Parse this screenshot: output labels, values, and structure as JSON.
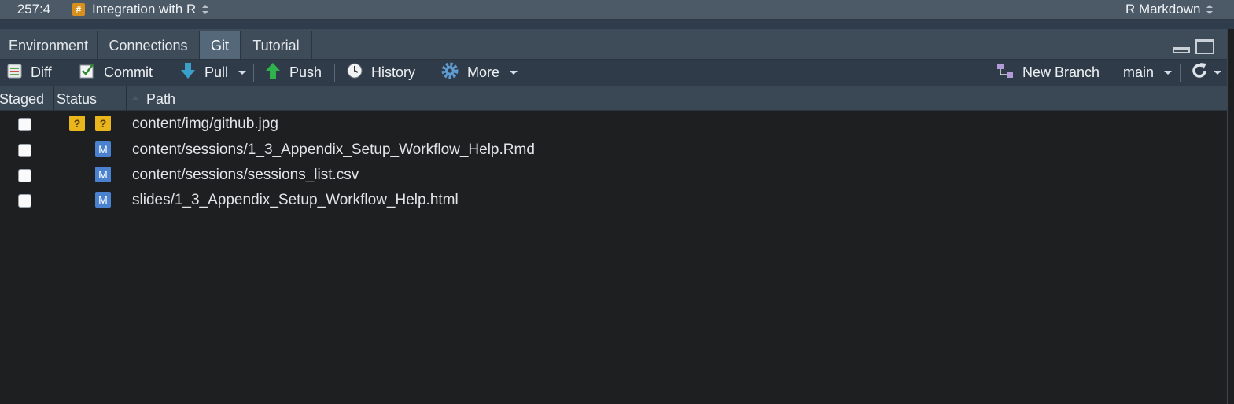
{
  "statusbar": {
    "cursor_position": "257:4",
    "section_icon": "hash-icon",
    "section_name": "Integration with R",
    "doc_type": "R Markdown"
  },
  "tabs": [
    {
      "label": "Environment",
      "active": false
    },
    {
      "label": "Connections",
      "active": false
    },
    {
      "label": "Git",
      "active": true
    },
    {
      "label": "Tutorial",
      "active": false
    }
  ],
  "toolbar": {
    "diff": "Diff",
    "commit": "Commit",
    "pull": "Pull",
    "push": "Push",
    "history": "History",
    "more": "More",
    "new_branch": "New Branch",
    "branch": "main"
  },
  "columns": {
    "staged": "Staged",
    "status": "Status",
    "path": "Path"
  },
  "files": [
    {
      "staged": false,
      "status_staged": "?",
      "status_unstaged": "?",
      "path": "content/img/github.jpg"
    },
    {
      "staged": false,
      "status_staged": "",
      "status_unstaged": "M",
      "path": "content/sessions/1_3_Appendix_Setup_Workflow_Help.Rmd"
    },
    {
      "staged": false,
      "status_staged": "",
      "status_unstaged": "M",
      "path": "content/sessions/sessions_list.csv"
    },
    {
      "staged": false,
      "status_staged": "",
      "status_unstaged": "M",
      "path": "slides/1_3_Appendix_Setup_Workflow_Help.html"
    }
  ],
  "colors": {
    "untracked": "#e9b71d",
    "modified": "#4b82cf",
    "active_tab": "#55687a",
    "background": "#1e1f21"
  }
}
